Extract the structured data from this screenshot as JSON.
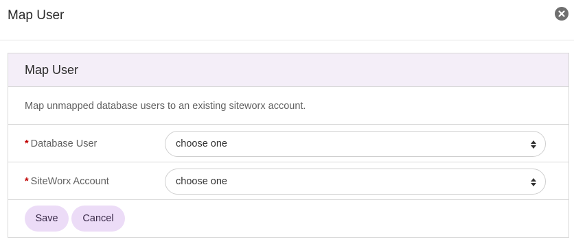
{
  "modal": {
    "title": "Map User"
  },
  "panel": {
    "title": "Map User",
    "description": "Map unmapped database users to an existing siteworx account."
  },
  "form": {
    "database_user": {
      "required_marker": "*",
      "label": "Database User",
      "value": "choose one"
    },
    "siteworx_account": {
      "required_marker": "*",
      "label": "SiteWorx Account",
      "value": "choose one"
    }
  },
  "actions": {
    "save_label": "Save",
    "cancel_label": "Cancel"
  },
  "icons": {
    "close": "close-circle-icon",
    "select_caret": "sort-caret-icon"
  },
  "colors": {
    "panel_heading_bg": "#f4eef8",
    "button_bg": "#ecdcf7",
    "required": "#c00000"
  }
}
